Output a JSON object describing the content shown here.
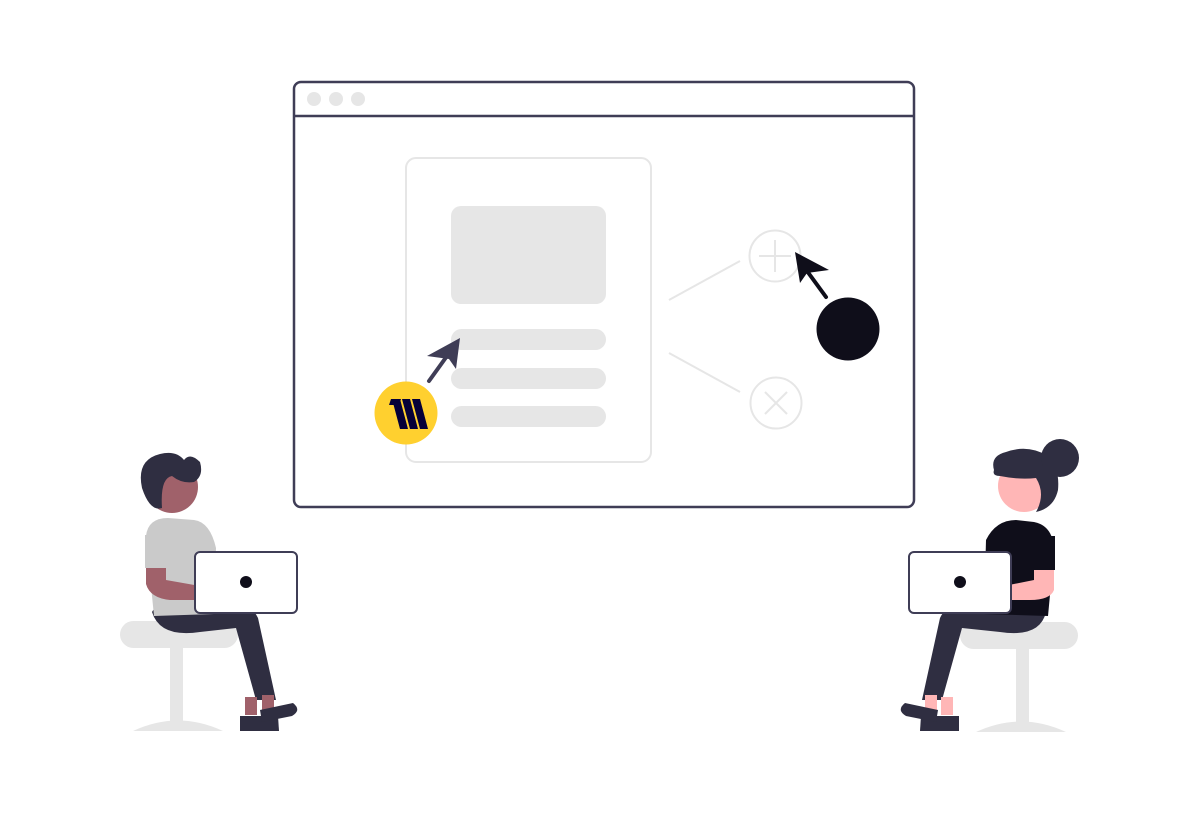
{
  "colors": {
    "outline": "#3f3d56",
    "light_gray": "#e6e6e6",
    "panel_border": "#e6e6e6",
    "dark": "#0f0e1a",
    "ink": "#2f2e41",
    "miro_yellow": "#ffd02f",
    "miro_mark": "#050038",
    "skin_left": "#a0616a",
    "skin_right": "#ffb6b6",
    "shirt_left": "#cacaca",
    "shirt_right": "#0f0e1a",
    "laptop_fill": "#ffffff"
  },
  "browser": {
    "window_dots": [
      "dot-1",
      "dot-2",
      "dot-3"
    ]
  },
  "icons": {
    "plus": "plus-circle-icon",
    "close": "x-circle-icon",
    "cursor": "arrow-cursor-icon",
    "logo": "miro-logo-icon"
  }
}
